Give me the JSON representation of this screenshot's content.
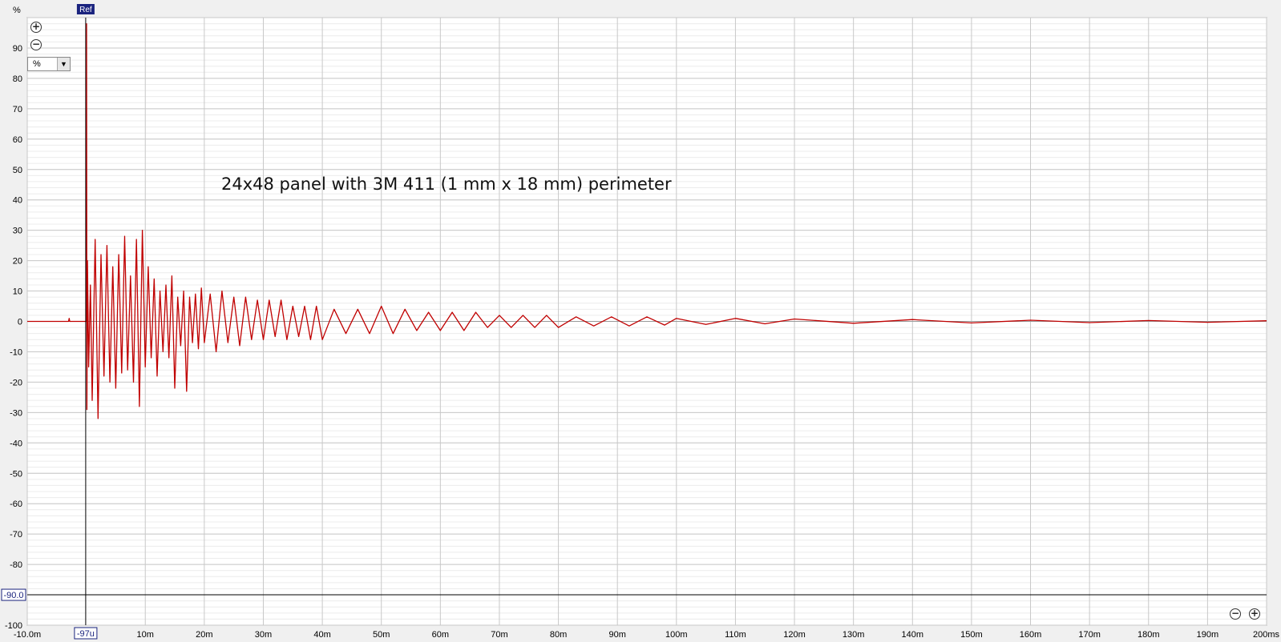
{
  "chart_data": {
    "type": "line",
    "title": "24x48 panel with 3M 411 (1 mm x 18 mm) perimeter",
    "ylabel": "%",
    "xlim": [
      -0.01,
      0.2
    ],
    "ylim": [
      -100,
      100
    ],
    "x_ticks": [
      {
        "v": -0.01,
        "label": "-10.0m"
      },
      {
        "v": 0.01,
        "label": "10m"
      },
      {
        "v": 0.02,
        "label": "20m"
      },
      {
        "v": 0.03,
        "label": "30m"
      },
      {
        "v": 0.04,
        "label": "40m"
      },
      {
        "v": 0.05,
        "label": "50m"
      },
      {
        "v": 0.06,
        "label": "60m"
      },
      {
        "v": 0.07,
        "label": "70m"
      },
      {
        "v": 0.08,
        "label": "80m"
      },
      {
        "v": 0.09,
        "label": "90m"
      },
      {
        "v": 0.1,
        "label": "100m"
      },
      {
        "v": 0.11,
        "label": "110m"
      },
      {
        "v": 0.12,
        "label": "120m"
      },
      {
        "v": 0.13,
        "label": "130m"
      },
      {
        "v": 0.14,
        "label": "140m"
      },
      {
        "v": 0.15,
        "label": "150m"
      },
      {
        "v": 0.16,
        "label": "160m"
      },
      {
        "v": 0.17,
        "label": "170m"
      },
      {
        "v": 0.18,
        "label": "180m"
      },
      {
        "v": 0.19,
        "label": "190m"
      },
      {
        "v": 0.2,
        "label": "200ms"
      }
    ],
    "y_ticks": [
      90,
      80,
      70,
      60,
      50,
      40,
      30,
      20,
      10,
      0,
      -10,
      -20,
      -30,
      -40,
      -50,
      -60,
      -70,
      -80,
      -100
    ],
    "grid": true,
    "series": [
      {
        "color": "#c00000",
        "x": [
          -0.01,
          -0.003,
          -0.0029,
          -0.0028,
          -0.001,
          0.0,
          5e-05,
          0.0001,
          0.0002,
          0.0004,
          0.0007,
          0.001,
          0.0015,
          0.002,
          0.0025,
          0.003,
          0.0035,
          0.004,
          0.0045,
          0.005,
          0.0055,
          0.006,
          0.0065,
          0.007,
          0.0075,
          0.008,
          0.0085,
          0.009,
          0.0095,
          0.01,
          0.0105,
          0.011,
          0.0115,
          0.012,
          0.0125,
          0.013,
          0.0135,
          0.014,
          0.0145,
          0.015,
          0.0155,
          0.016,
          0.0165,
          0.017,
          0.0175,
          0.018,
          0.0185,
          0.019,
          0.0195,
          0.02,
          0.021,
          0.022,
          0.023,
          0.024,
          0.025,
          0.026,
          0.027,
          0.028,
          0.029,
          0.03,
          0.031,
          0.032,
          0.033,
          0.034,
          0.035,
          0.036,
          0.037,
          0.038,
          0.039,
          0.04,
          0.042,
          0.044,
          0.046,
          0.048,
          0.05,
          0.052,
          0.054,
          0.056,
          0.058,
          0.06,
          0.062,
          0.064,
          0.066,
          0.068,
          0.07,
          0.072,
          0.074,
          0.076,
          0.078,
          0.08,
          0.083,
          0.086,
          0.089,
          0.092,
          0.095,
          0.098,
          0.1,
          0.105,
          0.11,
          0.115,
          0.12,
          0.13,
          0.14,
          0.15,
          0.16,
          0.17,
          0.18,
          0.19,
          0.2
        ],
        "y": [
          0,
          0,
          1,
          0,
          0,
          0,
          98,
          -29,
          20,
          -15,
          12,
          -26,
          27,
          -32,
          22,
          -18,
          25,
          -20,
          18,
          -22,
          22,
          -17,
          28,
          -16,
          15,
          -20,
          27,
          -28,
          30,
          -15,
          18,
          -12,
          14,
          -18,
          10,
          -10,
          12,
          -12,
          15,
          -22,
          8,
          -8,
          10,
          -23,
          8,
          -7,
          9,
          -9,
          11,
          -7,
          9,
          -10,
          10,
          -7,
          8,
          -8,
          8,
          -6,
          7,
          -6,
          7,
          -5,
          7,
          -6,
          5,
          -5,
          5,
          -6,
          5,
          -6,
          4,
          -4,
          4,
          -4,
          5,
          -4,
          4,
          -3,
          3,
          -3,
          3,
          -3,
          3,
          -2,
          2,
          -2,
          2,
          -2,
          2,
          -2,
          1.5,
          -1.5,
          1.5,
          -1.5,
          1.5,
          -1.2,
          1,
          -1,
          1,
          -0.8,
          0.8,
          -0.6,
          0.6,
          -0.5,
          0.4,
          -0.4,
          0.3,
          -0.3,
          0.2
        ]
      }
    ],
    "reference_marker": {
      "label": "Ref",
      "x_label": "-97u",
      "x": -9.7e-05
    },
    "level_marker": {
      "label": "-90.0",
      "y": -90
    }
  },
  "controls": {
    "unit_value": "%",
    "zoom_in_glyph": "+",
    "zoom_out_glyph": "−"
  }
}
